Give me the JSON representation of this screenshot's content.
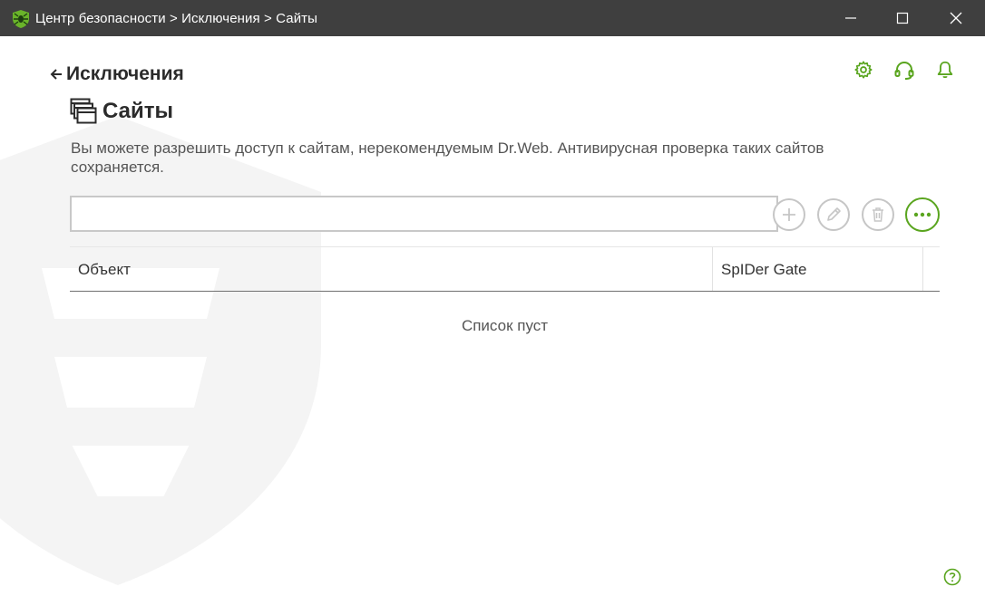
{
  "window": {
    "title": "Центр безопасности > Исключения > Сайты",
    "app_icon": "drweb-spider-icon",
    "controls": [
      "minimize-icon",
      "maximize-icon",
      "close-icon"
    ]
  },
  "header": {
    "back_label": "Исключения",
    "icons": [
      "gear-icon",
      "headset-icon",
      "bell-icon"
    ]
  },
  "page": {
    "title": "Сайты",
    "title_icon": "windows-stack-icon",
    "description": "Вы можете разрешить доступ к сайтам, нерекомендуемым Dr.Web. Антивирусная проверка таких сайтов сохраняется."
  },
  "search": {
    "value": "",
    "placeholder": ""
  },
  "toolbar": {
    "buttons": [
      "plus-icon",
      "pencil-icon",
      "trash-icon",
      "more-icon"
    ]
  },
  "table": {
    "columns": [
      "Объект",
      "SpIDer Gate"
    ],
    "rows": [],
    "empty_text": "Список пуст"
  },
  "colors": {
    "titlebar_bg": "#3f3f3f",
    "accent": "#5aa51f",
    "disabled_icon": "#c6c6c6",
    "text": "#2b2b2b"
  },
  "help_icon": "question-icon"
}
